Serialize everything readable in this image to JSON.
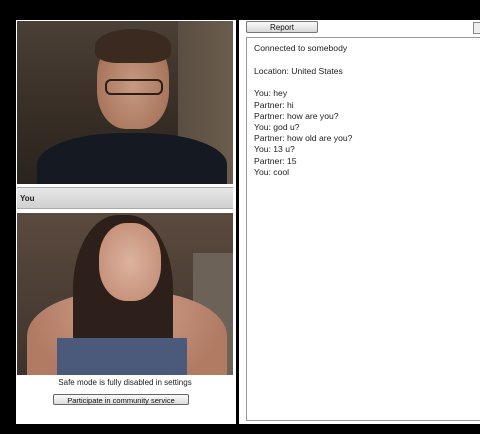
{
  "left_panel": {
    "you_label": "You",
    "safe_mode_text": "Safe mode is fully disabled in settings",
    "community_button_label": "Participate in community service"
  },
  "right_panel": {
    "report_button_label": "Report",
    "status_text": "Connected to somebody",
    "location_text": "Location: United States",
    "messages": [
      "You: hey",
      "Partner: hi",
      "Partner: how are you?",
      "You: god u?",
      "Partner: how old are you?",
      "You: 13 u?",
      "Partner: 15",
      "You: cool"
    ]
  }
}
